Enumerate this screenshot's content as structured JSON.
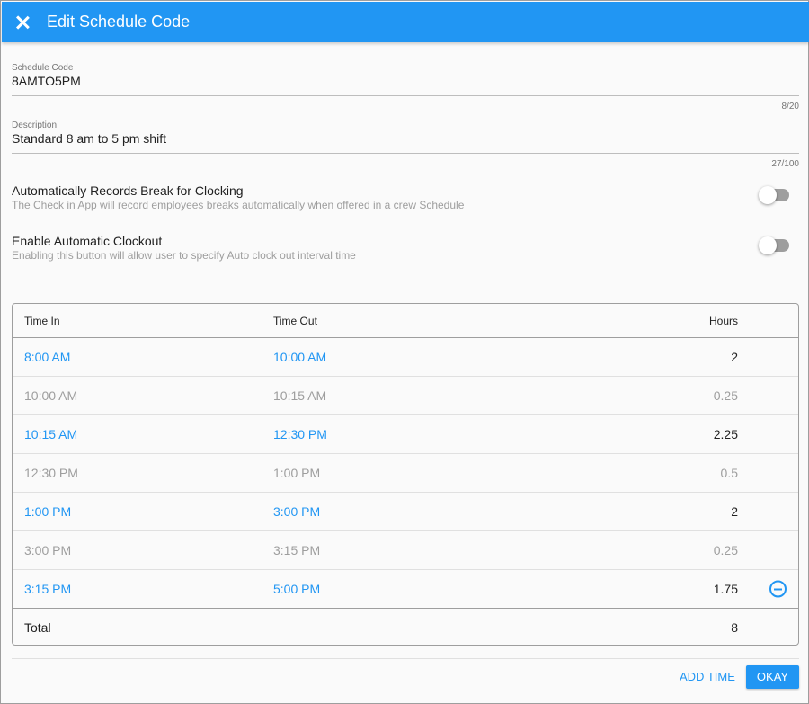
{
  "header": {
    "title": "Edit Schedule Code",
    "close_icon": "close-icon"
  },
  "fields": {
    "schedule_code": {
      "label": "Schedule Code",
      "value": "8AMTO5PM",
      "counter": "8/20"
    },
    "description": {
      "label": "Description",
      "value": "Standard 8 am to 5 pm shift",
      "counter": "27/100"
    }
  },
  "toggles": [
    {
      "title": "Automatically Records Break for Clocking",
      "subtitle": "The Check in App will record employees breaks automatically when offered in a crew Schedule",
      "on": false
    },
    {
      "title": "Enable Automatic Clockout",
      "subtitle": "Enabling this button will allow user to specify Auto clock out interval time",
      "on": false
    }
  ],
  "table": {
    "headers": {
      "time_in": "Time In",
      "time_out": "Time Out",
      "hours": "Hours"
    },
    "rows": [
      {
        "time_in": "8:00 AM",
        "time_out": "10:00 AM",
        "hours": "2",
        "type": "work"
      },
      {
        "time_in": "10:00 AM",
        "time_out": "10:15 AM",
        "hours": "0.25",
        "type": "break"
      },
      {
        "time_in": "10:15 AM",
        "time_out": "12:30 PM",
        "hours": "2.25",
        "type": "work"
      },
      {
        "time_in": "12:30 PM",
        "time_out": "1:00 PM",
        "hours": "0.5",
        "type": "break"
      },
      {
        "time_in": "1:00 PM",
        "time_out": "3:00 PM",
        "hours": "2",
        "type": "work"
      },
      {
        "time_in": "3:00 PM",
        "time_out": "3:15 PM",
        "hours": "0.25",
        "type": "break"
      },
      {
        "time_in": "3:15 PM",
        "time_out": "5:00 PM",
        "hours": "1.75",
        "type": "work"
      }
    ],
    "total": {
      "label": "Total",
      "hours": "8"
    }
  },
  "actions": {
    "add_time": "ADD TIME",
    "okay": "OKAY"
  },
  "colors": {
    "accent": "#2196f3",
    "break_text": "#9e9e9e"
  }
}
